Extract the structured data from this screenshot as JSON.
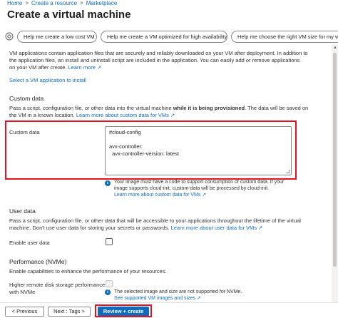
{
  "breadcrumb": {
    "items": [
      "Home",
      "Create a resource",
      "Marketplace"
    ],
    "separator": ">"
  },
  "page": {
    "title": "Create a virtual machine",
    "more": "···"
  },
  "copilot": {
    "prompts": [
      "Help me create a low cost VM",
      "Help me create a VM optimized for high availability",
      "Help me choose the right VM size for my workl"
    ]
  },
  "vm_apps": {
    "description_line1": "VM applications contain application files that are securely and reliably downloaded on your VM after deployment. In addition to",
    "description_line2": "the application files, an install and uninstall script are included in the application. You can easily add or remove applications",
    "description_line3": "on your VM after create.",
    "learn_more": "Learn more",
    "select_link": "Select a VM application to install"
  },
  "custom_data": {
    "section_title": "Custom data",
    "description_line1_a": "Pass a script, configuration file, or other data into the virtual machine ",
    "description_line1_bold": "while it is being provisioned",
    "description_line1_b": ". The data will be saved on",
    "description_line2": "the VM in a known location.",
    "learn_more": "Learn more about custom data for VMs",
    "field_label": "Custom data",
    "value": "#cloud-config\n\navx-controller:\n  avx-controller-version: latest",
    "info_line1": "Your image must have a code to support consumption of custom data. If your",
    "info_line2": "image supports cloud-init, custom-data will be processed by cloud-init.",
    "info_link": "Learn more about custom data for VMs"
  },
  "user_data": {
    "section_title": "User data",
    "description_line1": "Pass a script, configuration file, or other data that will be accessible to your applications throughout the lifetime of the virtual",
    "description_line2": "machine. Don't use user data for storing your secrets or passwords.",
    "learn_more": "Learn more about user data for VMs",
    "enable_label": "Enable user data"
  },
  "performance": {
    "section_title": "Performance (NVMe)",
    "description": "Enable capabilities to enhance the performance of your resources.",
    "field_label_line1": "Higher remote disk storage performance",
    "field_label_line2": "with NVMe",
    "info_line1": "The selected image and size are not supported for NVMe.",
    "info_link": "See supported VM images and sizes"
  },
  "footer": {
    "previous": "< Previous",
    "next": "Next : Tags >",
    "review": "Review + create"
  },
  "colors": {
    "link": "#0f6cbd",
    "primary": "#0f6cbd",
    "highlight": "#e81123"
  }
}
